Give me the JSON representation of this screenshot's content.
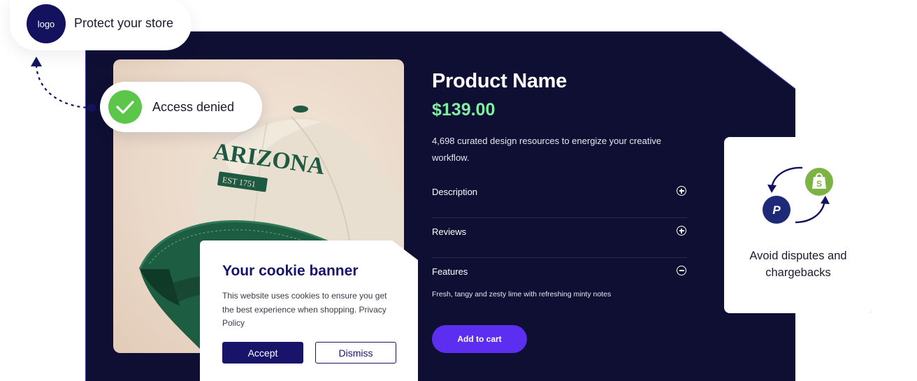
{
  "header": {
    "logo_label": "logo",
    "protect_text": "Protect your store"
  },
  "access": {
    "text": "Access denied",
    "icon": "check-icon",
    "color": "#5cc64a"
  },
  "product": {
    "name": "Product Name",
    "price": "$139.00",
    "description": "4,698 curated design resources to energize your creative workflow.",
    "image": {
      "embroidery_title": "ARIZONA",
      "embroidery_sub": "EST 1751"
    },
    "accordion": [
      {
        "label": "Description",
        "icon": "plus-circle-icon",
        "expanded": false
      },
      {
        "label": "Reviews",
        "icon": "plus-circle-icon",
        "expanded": false
      },
      {
        "label": "Features",
        "icon": "minus-circle-icon",
        "expanded": true,
        "content": "Fresh, tangy and zesty lime with refreshing minty notes"
      }
    ],
    "cta_label": "Add to cart",
    "colors": {
      "panel": "#0f0e33",
      "price": "#7ff0a2",
      "cta": "#5b2ef0"
    }
  },
  "cookie_banner": {
    "title": "Your cookie banner",
    "text": "This website uses cookies to ensure you get the best experience when shopping. Privacy Policy",
    "accept_label": "Accept",
    "dismiss_label": "Dismiss"
  },
  "dispute_card": {
    "text": "Avoid disputes and chargebacks",
    "icons": [
      "paypal-icon",
      "shopify-icon"
    ]
  }
}
